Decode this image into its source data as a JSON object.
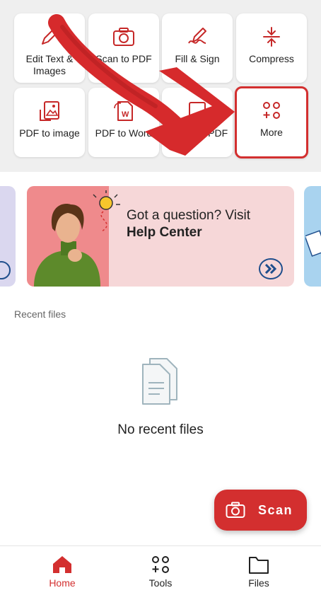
{
  "tools": [
    {
      "label": "Edit Text & Images",
      "icon": "pencil-icon"
    },
    {
      "label": "Scan to PDF",
      "icon": "camera-icon"
    },
    {
      "label": "Fill & Sign",
      "icon": "pen-sign-icon"
    },
    {
      "label": "Compress",
      "icon": "compress-icon"
    },
    {
      "label": "PDF to image",
      "icon": "pdf-image-icon"
    },
    {
      "label": "PDF to Word",
      "icon": "pdf-word-icon"
    },
    {
      "label": "Image to PDF",
      "icon": "image-pdf-icon"
    },
    {
      "label": "More",
      "icon": "more-grid-icon"
    }
  ],
  "banner": {
    "line1": "Got a question? Visit",
    "line2": "Help Center"
  },
  "recent": {
    "label": "Recent files",
    "empty": "No recent files"
  },
  "scan_button": {
    "label": "Scan"
  },
  "nav": [
    {
      "label": "Home",
      "active": true
    },
    {
      "label": "Tools",
      "active": false
    },
    {
      "label": "Files",
      "active": false
    }
  ],
  "colors": {
    "accent": "#d32f2f",
    "banner_bg": "#f6d7d8",
    "link_blue": "#1f4e8c"
  }
}
